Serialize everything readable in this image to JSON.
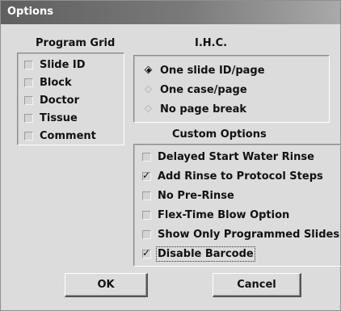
{
  "window": {
    "title": "Options"
  },
  "program_grid": {
    "label": "Program Grid",
    "items": [
      {
        "label": "Slide ID",
        "checked": false
      },
      {
        "label": "Block",
        "checked": false
      },
      {
        "label": "Doctor",
        "checked": false
      },
      {
        "label": "Tissue",
        "checked": false
      },
      {
        "label": "Comment",
        "checked": false
      }
    ]
  },
  "ihc": {
    "label": "I.H.C.",
    "options": [
      {
        "label": "One slide ID/page",
        "selected": true
      },
      {
        "label": "One case/page",
        "selected": false
      },
      {
        "label": "No page break",
        "selected": false
      }
    ]
  },
  "custom_options": {
    "label": "Custom Options",
    "items": [
      {
        "label": "Delayed Start Water Rinse",
        "checked": false
      },
      {
        "label": "Add Rinse to Protocol Steps",
        "checked": true
      },
      {
        "label": "No Pre-Rinse",
        "checked": false
      },
      {
        "label": "Flex-Time Blow Option",
        "checked": false
      },
      {
        "label": "Show Only Programmed Slides",
        "checked": false
      },
      {
        "label": "Disable Barcode",
        "checked": true
      }
    ]
  },
  "buttons": {
    "ok": "OK",
    "cancel": "Cancel"
  }
}
